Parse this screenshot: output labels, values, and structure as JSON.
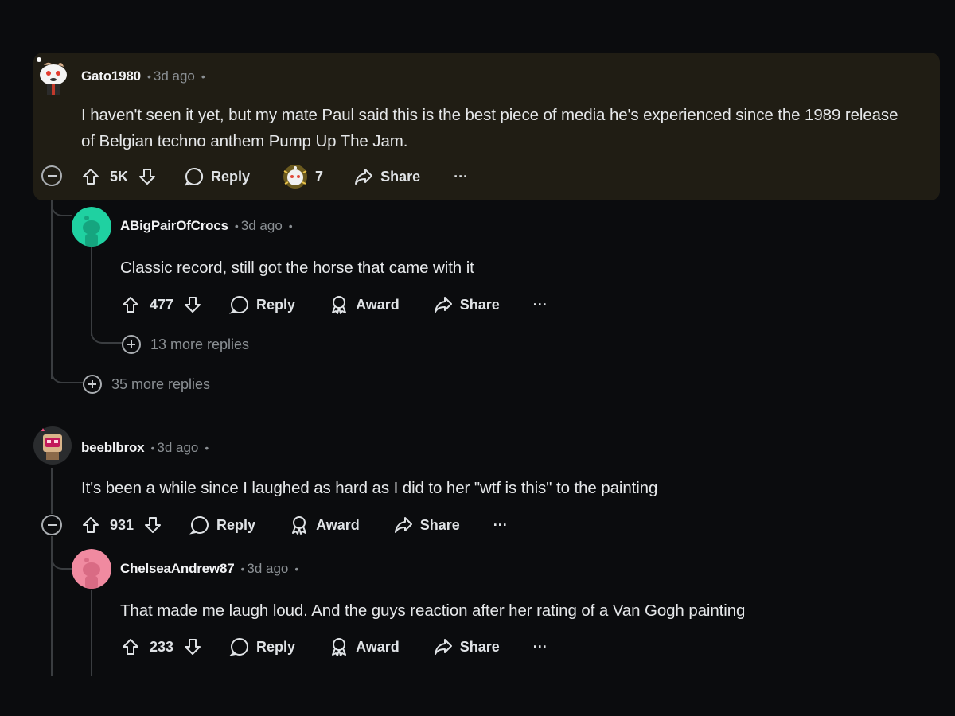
{
  "comments": [
    {
      "username": "Gato1980",
      "time": "3d ago",
      "body": "I haven't seen it yet, but my mate Paul said this is the best piece of media he's experienced since the 1989 release of Belgian techno anthem Pump Up The Jam.",
      "votes": "5K",
      "reply_label": "Reply",
      "award_count": "7",
      "share_label": "Share",
      "more_label": "···",
      "avatar_color": "#2a2a2a",
      "highlight_color": "#201d14"
    },
    {
      "username": "ABigPairOfCrocs",
      "time": "3d ago",
      "body": "Classic record, still got the horse that came with it",
      "votes": "477",
      "reply_label": "Reply",
      "award_label": "Award",
      "share_label": "Share",
      "more_label": "···",
      "more_replies": "13 more replies",
      "avatar_color": "#1fd1a1"
    },
    {
      "thread_more_replies": "35 more replies"
    },
    {
      "username": "beeblbrox",
      "time": "3d ago",
      "body": "It's been a while since I laughed as hard as I did to her \"wtf is this\" to the painting",
      "votes": "931",
      "reply_label": "Reply",
      "award_label": "Award",
      "share_label": "Share",
      "more_label": "···",
      "avatar_color": "#2a2c2e"
    },
    {
      "username": "ChelseaAndrew87",
      "time": "3d ago",
      "body": "That made me laugh loud. And the guys reaction after her rating of a Van Gogh painting",
      "votes": "233",
      "reply_label": "Reply",
      "award_label": "Award",
      "share_label": "Share",
      "more_label": "···",
      "avatar_color": "#f08aa0"
    }
  ],
  "separator": "•"
}
